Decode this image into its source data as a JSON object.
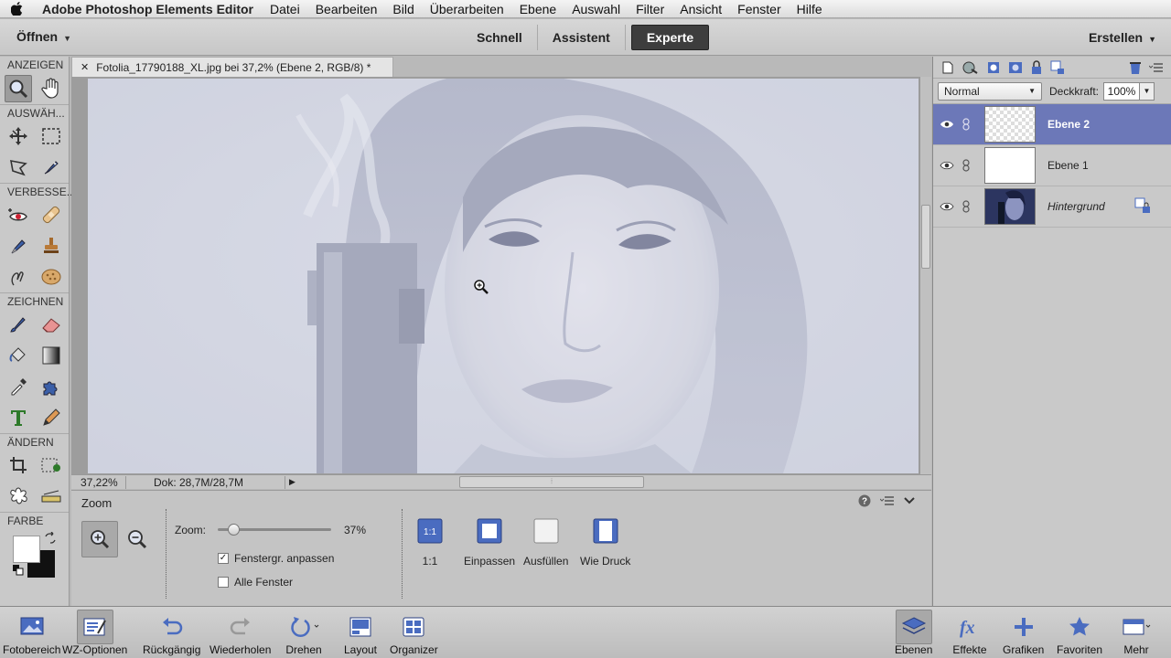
{
  "menubar": {
    "app_name": "Adobe Photoshop Elements Editor",
    "menus": [
      "Datei",
      "Bearbeiten",
      "Bild",
      "Überarbeiten",
      "Ebene",
      "Auswahl",
      "Filter",
      "Ansicht",
      "Fenster",
      "Hilfe"
    ]
  },
  "header": {
    "open_label": "Öffnen",
    "modes": [
      "Schnell",
      "Assistent",
      "Experte"
    ],
    "active_mode": "Experte",
    "create_label": "Erstellen"
  },
  "toolbox": {
    "sections": [
      "ANZEIGEN",
      "AUSWÄH...",
      "VERBESSE...",
      "ZEICHNEN",
      "ÄNDERN",
      "FARBE"
    ]
  },
  "document": {
    "tab_title": "Fotolia_17790188_XL.jpg bei 37,2% (Ebene 2, RGB/8) *",
    "status_zoom": "37,22%",
    "status_doc": "Dok: 28,7M/28,7M"
  },
  "options": {
    "title": "Zoom",
    "zoom_label": "Zoom:",
    "zoom_value": "37%",
    "zoom_fraction": 0.1,
    "resize_windows_label": "Fenstergr. anpassen",
    "resize_windows_checked": true,
    "all_windows_label": "Alle Fenster",
    "all_windows_checked": false,
    "fit_buttons": [
      "1:1",
      "Einpassen",
      "Ausfüllen",
      "Wie Druck"
    ],
    "one_to_one_icon_text": "1:1"
  },
  "layers": {
    "blend_mode": "Normal",
    "opacity_label": "Deckkraft:",
    "opacity_value": "100%",
    "items": [
      {
        "name": "Ebene 2",
        "active": true
      },
      {
        "name": "Ebene 1",
        "active": false
      },
      {
        "name": "Hintergrund",
        "active": false
      }
    ]
  },
  "taskbar": {
    "left": [
      "Fotobereich",
      "WZ-Optionen",
      "Rückgängig",
      "Wiederholen",
      "Drehen",
      "Layout",
      "Organizer"
    ],
    "right": [
      "Ebenen",
      "Effekte",
      "Grafiken",
      "Favoriten",
      "Mehr"
    ]
  },
  "colors": {
    "accent_layer": "#6c78b8",
    "active_mode_bg": "#3d3d3d",
    "tool_blue": "#3b5fa8"
  }
}
